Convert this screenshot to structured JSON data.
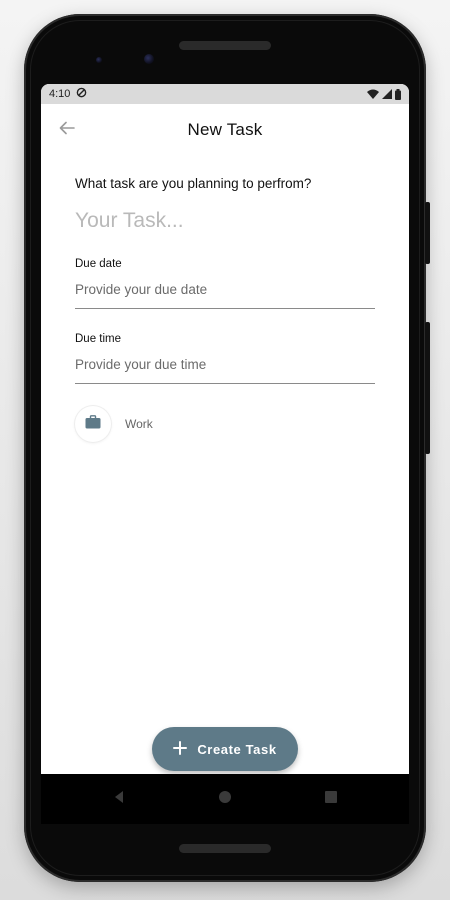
{
  "status_bar": {
    "time": "4:10"
  },
  "header": {
    "title": "New Task"
  },
  "form": {
    "question": "What task are you planning to perfrom?",
    "task_placeholder": "Your Task...",
    "due_date": {
      "label": "Due date",
      "placeholder": "Provide your due date"
    },
    "due_time": {
      "label": "Due time",
      "placeholder": "Provide your due time"
    },
    "category": {
      "label": "Work",
      "icon": "briefcase-icon"
    }
  },
  "fab": {
    "label": "Create Task",
    "icon": "plus-icon"
  },
  "colors": {
    "accent": "#5e7a88",
    "icon_slate": "#5e7a88",
    "status_bar_bg": "#dadada"
  }
}
